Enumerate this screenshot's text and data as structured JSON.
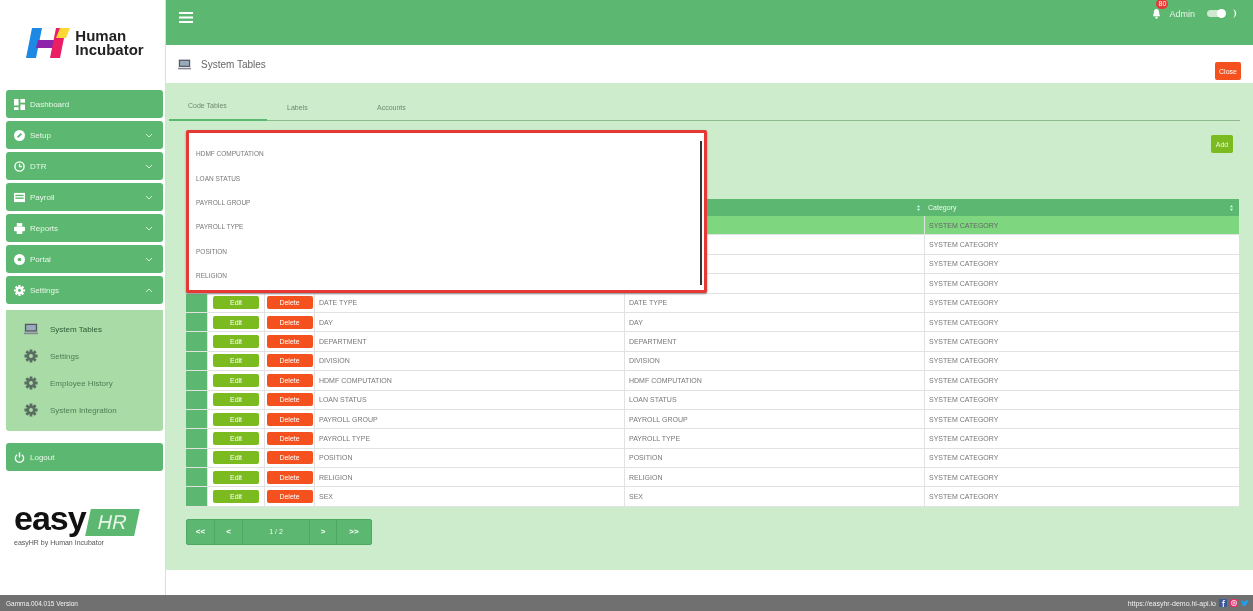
{
  "brand": {
    "line1": "Human",
    "line2": "Incubator"
  },
  "sidebar": {
    "items": [
      {
        "label": "Dashboard",
        "kind": "link"
      },
      {
        "label": "Setup",
        "kind": "group",
        "expanded": false
      },
      {
        "label": "DTR",
        "kind": "group",
        "expanded": false
      },
      {
        "label": "Payroll",
        "kind": "group",
        "expanded": false
      },
      {
        "label": "Reports",
        "kind": "group",
        "expanded": false
      },
      {
        "label": "Portal",
        "kind": "group",
        "expanded": false
      },
      {
        "label": "Settings",
        "kind": "group",
        "expanded": true,
        "children": [
          {
            "label": "System Tables",
            "selected": true
          },
          {
            "label": "Settings",
            "selected": false
          },
          {
            "label": "Employee History",
            "selected": false
          },
          {
            "label": "System Integration",
            "selected": false
          }
        ]
      }
    ],
    "logout": "Logout",
    "product": {
      "word": "easy",
      "badge": "HR",
      "tagline": "easyHR by Human Incubator"
    }
  },
  "topbar": {
    "notification_count": "80",
    "user": "Admin",
    "dark_mode": {
      "on": true
    }
  },
  "page": {
    "title": "System Tables",
    "close_button": "Close"
  },
  "tabs": [
    {
      "label": "Code Tables",
      "selected": true
    },
    {
      "label": "Labels",
      "selected": false
    },
    {
      "label": "Accounts",
      "selected": false
    }
  ],
  "add_button": "Add",
  "dropdown": {
    "options": [
      "HDMF COMPUTATION",
      "LOAN STATUS",
      "PAYROLL GROUP",
      "PAYROLL TYPE",
      "POSITION",
      "RELIGION"
    ]
  },
  "table": {
    "category_header": "Category",
    "rows": [
      {
        "category": "SYSTEM CATEGORY",
        "selected": true
      },
      {
        "category": "SYSTEM CATEGORY",
        "selected": false
      },
      {
        "category": "SYSTEM CATEGORY",
        "selected": false
      },
      {
        "category": "SYSTEM CATEGORY",
        "selected": false
      },
      {
        "edit": "Edit",
        "delete": "Delete",
        "name": "DATE TYPE",
        "description": "DATE TYPE",
        "category": "SYSTEM CATEGORY",
        "selected": false
      },
      {
        "edit": "Edit",
        "delete": "Delete",
        "name": "DAY",
        "description": "DAY",
        "category": "SYSTEM CATEGORY",
        "selected": false
      },
      {
        "edit": "Edit",
        "delete": "Delete",
        "name": "DEPARTMENT",
        "description": "DEPARTMENT",
        "category": "SYSTEM CATEGORY",
        "selected": false
      },
      {
        "edit": "Edit",
        "delete": "Delete",
        "name": "DIVISION",
        "description": "DIVISION",
        "category": "SYSTEM CATEGORY",
        "selected": false
      },
      {
        "edit": "Edit",
        "delete": "Delete",
        "name": "HDMF COMPUTATION",
        "description": "HDMF COMPUTATION",
        "category": "SYSTEM CATEGORY",
        "selected": false
      },
      {
        "edit": "Edit",
        "delete": "Delete",
        "name": "LOAN STATUS",
        "description": "LOAN STATUS",
        "category": "SYSTEM CATEGORY",
        "selected": false
      },
      {
        "edit": "Edit",
        "delete": "Delete",
        "name": "PAYROLL GROUP",
        "description": "PAYROLL GROUP",
        "category": "SYSTEM CATEGORY",
        "selected": false
      },
      {
        "edit": "Edit",
        "delete": "Delete",
        "name": "PAYROLL TYPE",
        "description": "PAYROLL TYPE",
        "category": "SYSTEM CATEGORY",
        "selected": false
      },
      {
        "edit": "Edit",
        "delete": "Delete",
        "name": "POSITION",
        "description": "POSITION",
        "category": "SYSTEM CATEGORY",
        "selected": false
      },
      {
        "edit": "Edit",
        "delete": "Delete",
        "name": "RELIGION",
        "description": "RELIGION",
        "category": "SYSTEM CATEGORY",
        "selected": false
      },
      {
        "edit": "Edit",
        "delete": "Delete",
        "name": "SEX",
        "description": "SEX",
        "category": "SYSTEM CATEGORY",
        "selected": false
      }
    ]
  },
  "pagination": {
    "first": "<<",
    "prev": "<",
    "page": "1 / 2",
    "next": ">",
    "last": ">>"
  },
  "footer": {
    "version": "Gamma.004.015 Version",
    "url": "https://easyhr-demo.hi-api.io"
  }
}
